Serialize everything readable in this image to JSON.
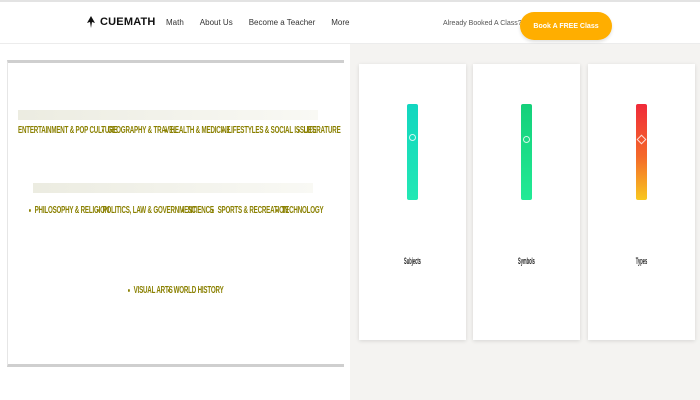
{
  "header": {
    "brand": "CUEMATH",
    "nav": [
      "Math",
      "About Us",
      "Become a Teacher",
      "More"
    ],
    "booked_text": "Already Booked A Class?",
    "cta_label": "Book A FREE Class"
  },
  "topics": {
    "row1": [
      "ENTERTAINMENT & POP CULTURE",
      "GEOGRAPHY & TRAVEL",
      "HEALTH & MEDICINE",
      "LIFESTYLES & SOCIAL ISSUES",
      "LITERATURE"
    ],
    "row2": [
      "PHILOSOPHY & RELIGION",
      "POLITICS, LAW & GOVERNMENT",
      "SCIENCE",
      "SPORTS & RECREATION",
      "TECHNOLOGY"
    ],
    "row3": [
      "VISUAL ARTS",
      "WORLD HISTORY"
    ]
  },
  "cards": [
    {
      "label": "Subjects",
      "color": "#1ee6c0",
      "icon": "chat-bubble-icon"
    },
    {
      "label": "Symbols",
      "color": "#1ce08a",
      "icon": "leaf-icon"
    },
    {
      "label": "Types",
      "color": "#f03a3a",
      "icon": "compass-icon"
    }
  ],
  "colors": {
    "accent": "#ffae00",
    "topic_text": "#8a8000"
  }
}
